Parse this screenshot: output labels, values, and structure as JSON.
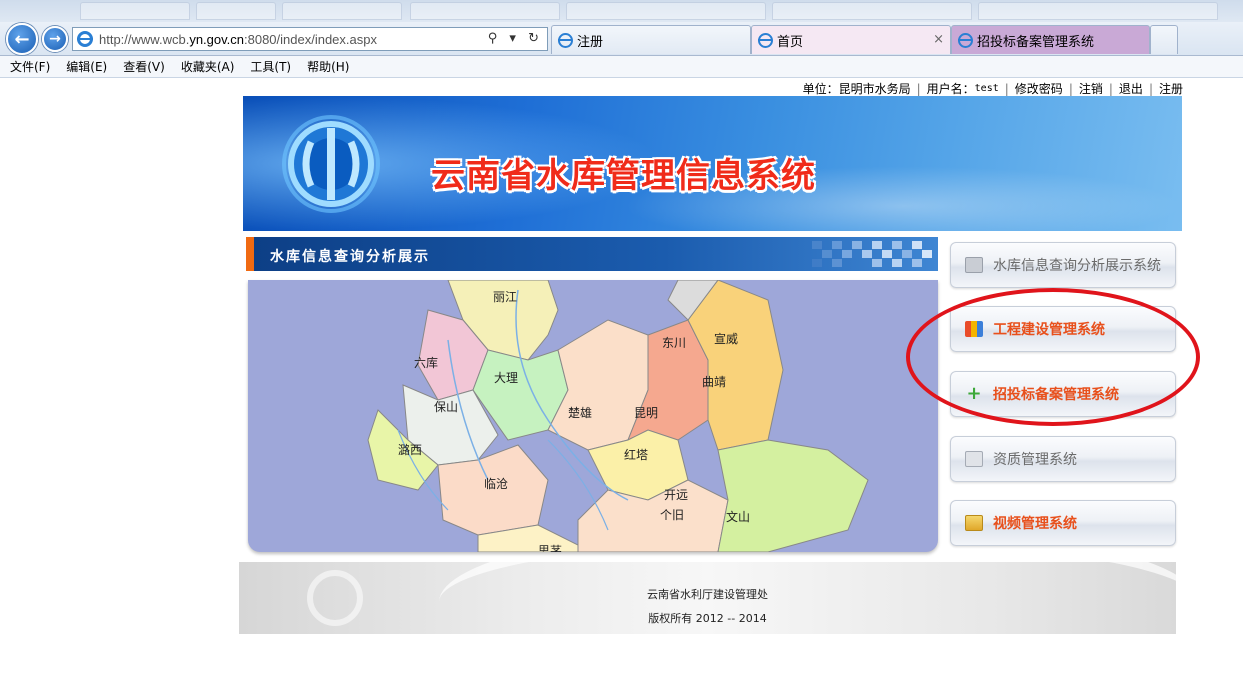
{
  "browser": {
    "url_prefix": "http://www.wcb.",
    "url_domain": "yn.gov.cn",
    "url_suffix": ":8080/index/index.aspx",
    "url_tools": "⚲ ▾ ↻",
    "tabs": [
      {
        "label": "注册",
        "active": false
      },
      {
        "label": "首页",
        "active": true
      },
      {
        "label": "招投标备案管理系统",
        "active": false
      }
    ],
    "close_glyph": "×",
    "menu": [
      "文件(F)",
      "编辑(E)",
      "查看(V)",
      "收藏夹(A)",
      "工具(T)",
      "帮助(H)"
    ]
  },
  "userbar": {
    "unit": "单位：昆明市水务局",
    "user_label": "用户名：",
    "user_value": "test",
    "links": [
      "修改密码",
      "注销",
      "退出",
      "注册"
    ]
  },
  "banner": {
    "title": "云南省水库管理信息系统"
  },
  "section": {
    "title": "水库信息查询分析展示"
  },
  "map": {
    "cities": [
      "丽江",
      "宣威",
      "东川",
      "六库",
      "大理",
      "曲靖",
      "保山",
      "楚雄",
      "昆明",
      "潞西",
      "红塔",
      "临沧",
      "开远",
      "个旧",
      "文山",
      "思茅"
    ]
  },
  "systems": [
    {
      "label": "水库信息查询分析展示系统",
      "style": "gray",
      "icon": "window-icon"
    },
    {
      "label": "工程建设管理系统",
      "style": "orange",
      "icon": "blocks-icon"
    },
    {
      "label": "招投标备案管理系统",
      "style": "orange",
      "icon": "plus-icon"
    },
    {
      "label": "资质管理系统",
      "style": "gray",
      "icon": "document-icon"
    },
    {
      "label": "视频管理系统",
      "style": "orange",
      "icon": "video-icon"
    }
  ],
  "footer": {
    "org": "云南省水利厅建设管理处",
    "copyright": "版权所有 2012 -- 2014"
  },
  "colors": {
    "accent_orange": "#e8501c",
    "highlight_red": "#e0141b",
    "banner_title": "#f02b1a",
    "section_blue": "#1b5cae"
  }
}
